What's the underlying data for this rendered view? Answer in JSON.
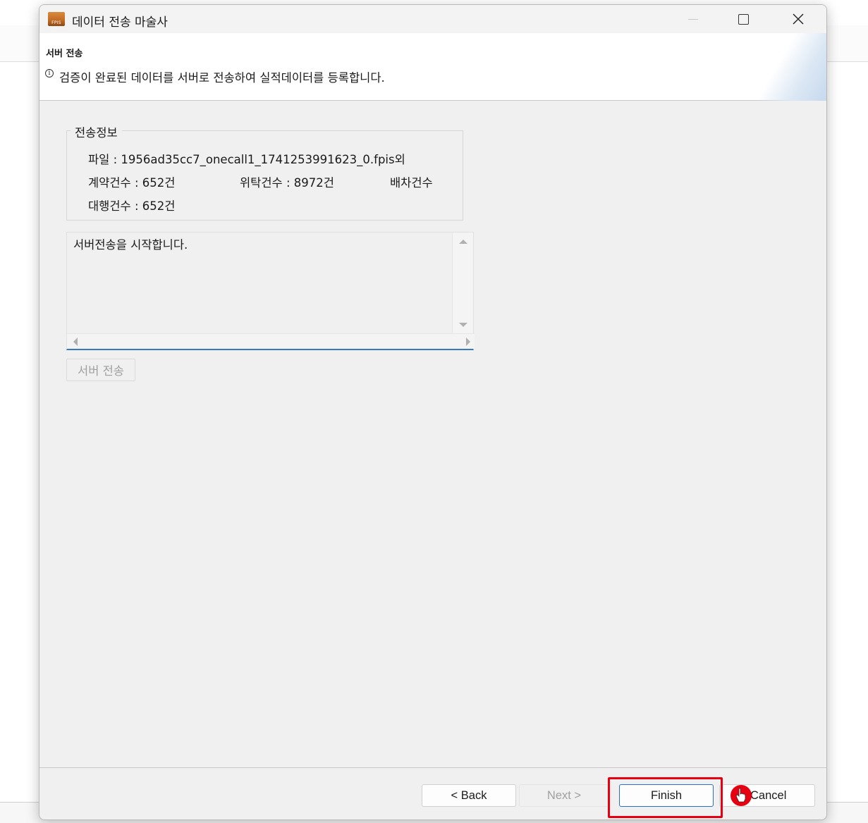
{
  "window": {
    "title": "데이터 전송 마술사",
    "app_icon_text": "FPIS"
  },
  "header": {
    "title": "서버 전송",
    "description": "검증이 완료된 데이터를 서버로 전송하여 실적데이터를 등록합니다.",
    "info_glyph": "i"
  },
  "transfer_info": {
    "legend": "전송정보",
    "file_line": "파일 : 1956ad35cc7_onecall1_1741253991623_0.fpis외",
    "contract_count": "계약건수 : 652건",
    "consign_count": "위탁건수 : 8972건",
    "dispatch_count": "배차건수",
    "agency_count": "대행건수 : 652건"
  },
  "log": {
    "text": "서버전송을 시작합니다."
  },
  "send_button": {
    "label": "서버 전송"
  },
  "wizard_buttons": {
    "back": "< Back",
    "next": "Next >",
    "finish": "Finish",
    "cancel": "Cancel"
  },
  "colors": {
    "highlight": "#e60012",
    "accent": "#2b6fcf",
    "window_bg": "#f0f0f0"
  }
}
